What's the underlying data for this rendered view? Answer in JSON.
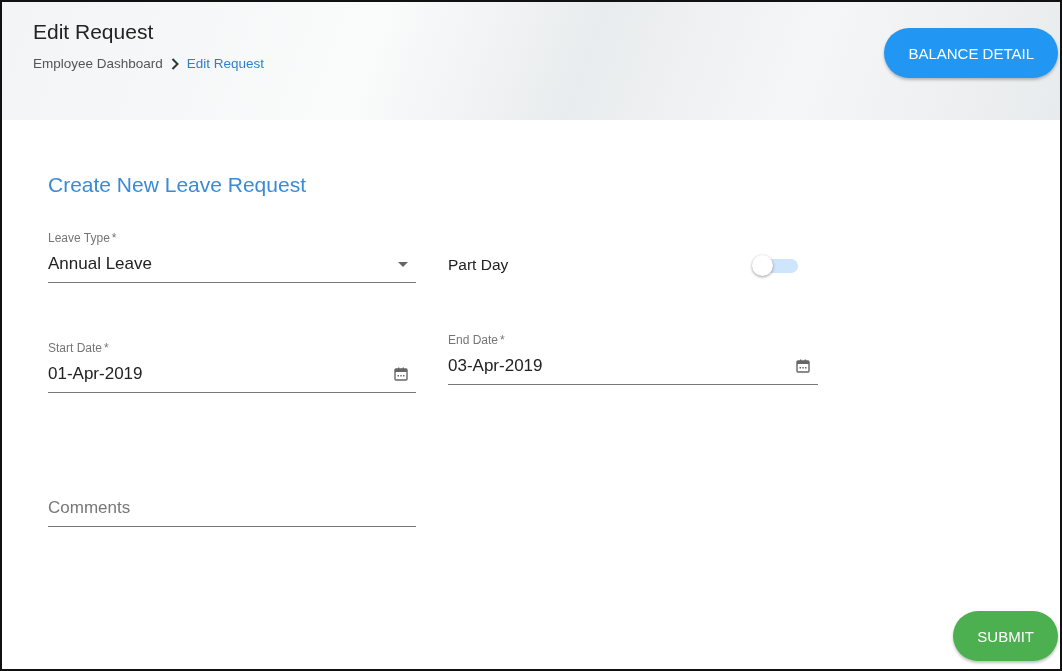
{
  "header": {
    "title": "Edit Request",
    "breadcrumb": [
      {
        "label": "Employee Dashboard",
        "current": false
      },
      {
        "label": "Edit Request",
        "current": true
      }
    ],
    "button": "BALANCE DETAIL"
  },
  "form": {
    "heading": "Create New Leave Request",
    "leave_type": {
      "label": "Leave Type",
      "required_mark": "*",
      "value": "Annual Leave"
    },
    "part_day": {
      "label": "Part Day",
      "on": false
    },
    "start_date": {
      "label": "Start Date",
      "required_mark": "*",
      "value": "01-Apr-2019"
    },
    "end_date": {
      "label": "End Date",
      "required_mark": "*",
      "value": "03-Apr-2019"
    },
    "comments": {
      "placeholder": "Comments"
    },
    "submit": "SUBMIT"
  }
}
